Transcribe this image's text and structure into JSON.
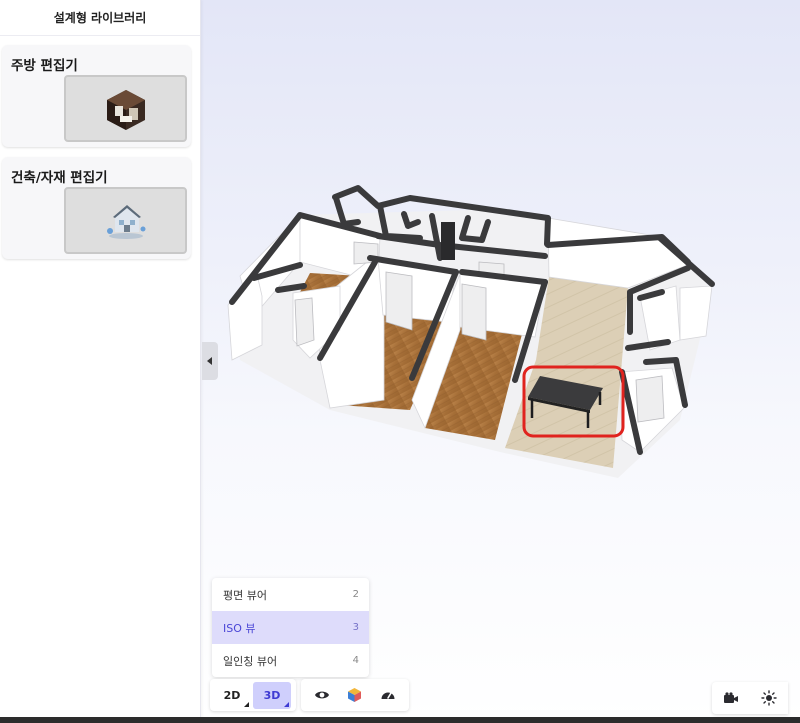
{
  "panel": {
    "title": "설계형 라이브러리",
    "cards": [
      {
        "title": "주방 편집기",
        "icon": "kitchen-thumbnail-icon"
      },
      {
        "title": "건축/자재 편집기",
        "icon": "house-thumbnail-icon"
      }
    ],
    "collapse_icon": "caret-left-icon"
  },
  "view_menu": {
    "items": [
      {
        "label": "평면 뷰어",
        "key": "2",
        "active": false
      },
      {
        "label": "ISO 뷰",
        "key": "3",
        "active": true
      },
      {
        "label": "일인칭 뷰어",
        "key": "4",
        "active": false
      }
    ]
  },
  "toolbar": {
    "mode_2d": "2D",
    "mode_3d": "3D",
    "active_mode": "3D",
    "tools": [
      "eye-icon",
      "cube-icon",
      "gauge-icon"
    ],
    "right_tools": [
      "video-camera-icon",
      "sun-icon"
    ]
  },
  "colors": {
    "accent": "#3f3bd3",
    "accent_bg": "#cfcffc",
    "menu_active_bg": "#dedcfb",
    "highlight_box": "#e0231e",
    "wall": "#3a3a3c",
    "floor_wood": "#a8743e",
    "floor_tile": "#dccfb6"
  }
}
